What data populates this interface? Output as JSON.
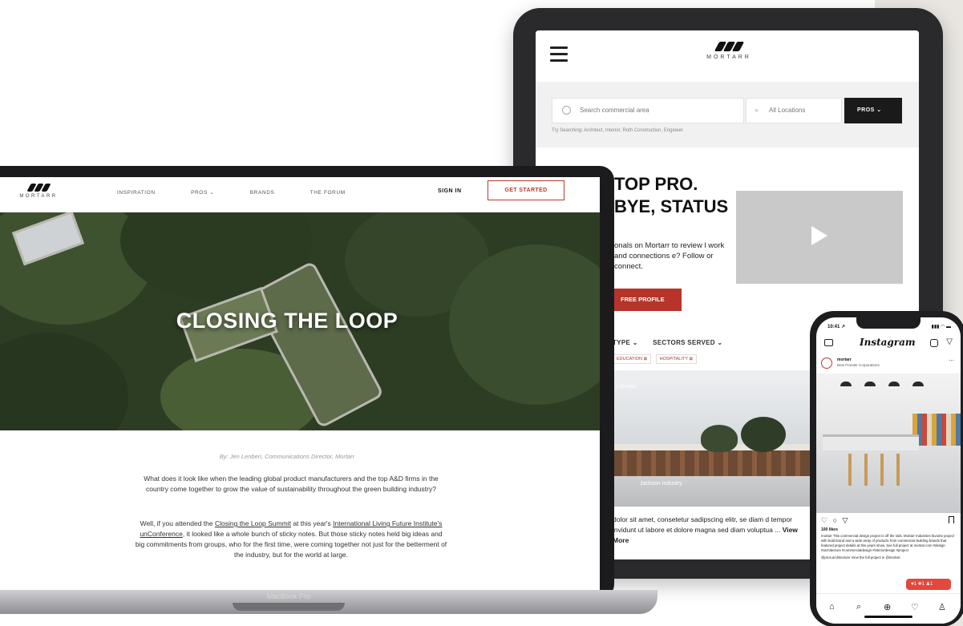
{
  "tablet": {
    "logo_word": "MORTARR",
    "search_placeholder": "Search commercial area",
    "location_placeholder": "All Locations",
    "pros_button": "PROS ⌄",
    "try_searching": "Try Searching: Architect, Interior, Roth Construction, Engineer",
    "hero_line1": "TOP PRO.",
    "hero_line2": "BYE, STATUS",
    "hero_text": "onals on Mortarr to review l work and connections e? Follow or connect.",
    "cta": "FREE PROFILE",
    "filter_type": "TYPE ⌄",
    "filter_sectors": "SECTORS SERVED ⌄",
    "chip1": "EDUCATION ⊠",
    "chip2": "HOSPITALITY ⊠",
    "photo_top": "s Orchids",
    "photo_caption": "Jackson Industry",
    "body_text": "dolor sit amet, consetetur sadipscing elitr, se diam d tempor invidunt ut labore et dolore magna sed diam voluptua ...",
    "view_more": "View More"
  },
  "laptop": {
    "logo_word": "MORTARR",
    "nav": [
      "INSPIRATION",
      "PROS ⌄",
      "BRANDS",
      "THE FORUM"
    ],
    "sign_in": "SIGN IN",
    "get_started": "GET STARTED",
    "hero_title": "CLOSING THE LOOP",
    "byline": "By: Jen Lenberi, Communications Director, Mortarr",
    "para1": "What does it look like when the leading global product manufacturers and the top A&D firms in the country come together to grow the value of sustainability throughout the green building industry?",
    "para2_a": "Well, if you attended the ",
    "para2_link1": "Closing the Loop Summit",
    "para2_b": " at this year's ",
    "para2_link2": "International Living Future Institute's unConference",
    "para2_c": ", it looked like a whole bunch of sticky notes. But those sticky notes held big ideas and big commitments from groups, who for the first time, were coming together not just for the betterment of the industry, but for the world at large.",
    "device_label": "MacBook Pro"
  },
  "phone": {
    "time": "10:41 ↗",
    "status_right": "▮▮▮ ◠ ▬",
    "app_title": "Instagram",
    "account": "mortarr",
    "location": "New Frontier Corporations",
    "likes": "100 likes",
    "caption": "mortarr This commercial design project is off the rails. Mortarr Industries favorite project with bold brand and a wide array of products from commercial building brands that featured project details at this years show. See full project at mortarr.com #design #architecture #commercialdesign #interiordesign #project",
    "comment": "@pros.architecture View the full project in @mortarr.",
    "notif": "♥1 ✚1 ♟1"
  },
  "colors": {
    "brand_red": "#c0392b",
    "dark": "#1a1a1a"
  }
}
